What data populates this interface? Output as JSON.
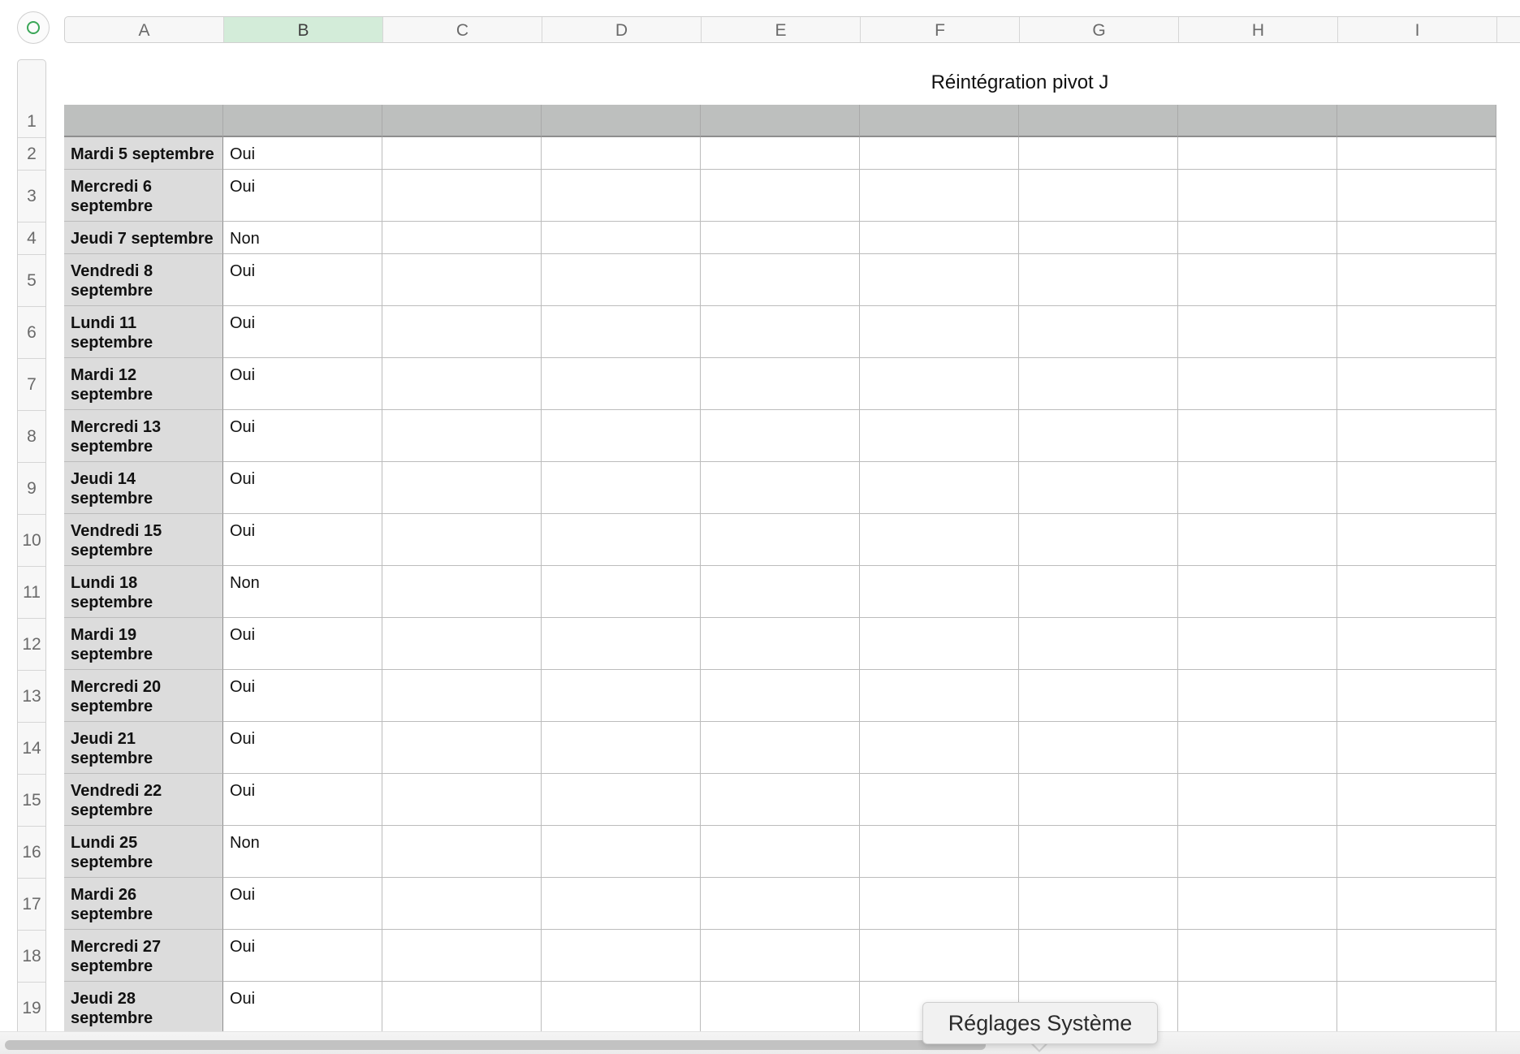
{
  "columns": [
    "A",
    "B",
    "C",
    "D",
    "E",
    "F",
    "G",
    "H",
    "I"
  ],
  "selected_column": "B",
  "table": {
    "title": "Réintégration pivot J",
    "rows": [
      {
        "num": "1",
        "label": "",
        "value": ""
      },
      {
        "num": "2",
        "label": "Mardi 5 septembre",
        "value": "Oui"
      },
      {
        "num": "3",
        "label": "Mercredi 6 septembre",
        "value": "Oui"
      },
      {
        "num": "4",
        "label": "Jeudi 7 septembre",
        "value": "Non"
      },
      {
        "num": "5",
        "label": "Vendredi 8 septembre",
        "value": "Oui"
      },
      {
        "num": "6",
        "label": "Lundi 11 septembre",
        "value": "Oui"
      },
      {
        "num": "7",
        "label": "Mardi 12 septembre",
        "value": "Oui"
      },
      {
        "num": "8",
        "label": "Mercredi 13 septembre",
        "value": "Oui"
      },
      {
        "num": "9",
        "label": "Jeudi 14 septembre",
        "value": "Oui"
      },
      {
        "num": "10",
        "label": "Vendredi 15 septembre",
        "value": "Oui"
      },
      {
        "num": "11",
        "label": "Lundi 18 septembre",
        "value": "Non"
      },
      {
        "num": "12",
        "label": "Mardi 19 septembre",
        "value": "Oui"
      },
      {
        "num": "13",
        "label": "Mercredi 20 septembre",
        "value": "Oui"
      },
      {
        "num": "14",
        "label": "Jeudi 21 septembre",
        "value": "Oui"
      },
      {
        "num": "15",
        "label": "Vendredi 22 septembre",
        "value": "Oui"
      },
      {
        "num": "16",
        "label": "Lundi 25 septembre",
        "value": "Non"
      },
      {
        "num": "17",
        "label": "Mardi 26 septembre",
        "value": "Oui"
      },
      {
        "num": "18",
        "label": "Mercredi 27 septembre",
        "value": "Oui"
      },
      {
        "num": "19",
        "label": "Jeudi 28 septembre",
        "value": "Oui"
      }
    ]
  },
  "tooltip": {
    "text": "Réglages Système"
  },
  "colors": {
    "selected_column_bg": "#d3ecd9",
    "header_row_bg": "#bdbfbe",
    "first_column_bg": "#dcdcdc",
    "accent_green": "#3aa657"
  }
}
